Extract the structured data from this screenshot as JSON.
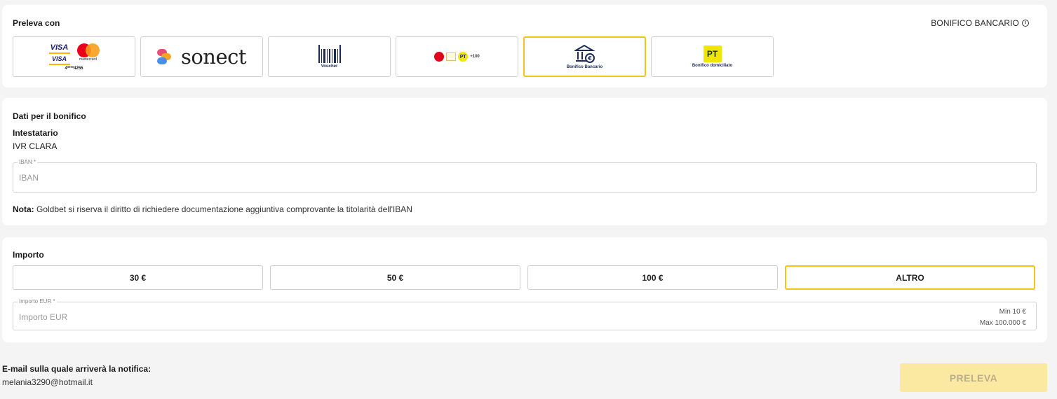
{
  "method_section": {
    "title": "Preleva con",
    "selected_method_label": "BONIFICO BANCARIO",
    "methods": [
      {
        "id": "card",
        "logo_text": "VISA",
        "logo_text_2": "VISA",
        "mc_label": "mastercard",
        "card_number": "4****4255"
      },
      {
        "id": "sonect",
        "logo_text": "sonect"
      },
      {
        "id": "voucher",
        "caption": "Voucher"
      },
      {
        "id": "multi",
        "badge": "PT",
        "extra": "+100"
      },
      {
        "id": "bonifico",
        "caption": "Bonifico Bancario",
        "selected": true
      },
      {
        "id": "domiciliato",
        "badge": "PT",
        "caption": "Bonifico domiciliato"
      }
    ]
  },
  "bonifico_section": {
    "title": "Dati per il bonifico",
    "holder_label": "Intestatario",
    "holder_value": "IVR CLARA",
    "iban_legend": "IBAN *",
    "iban_placeholder": "IBAN",
    "note_prefix": "Nota:",
    "note_text": " Goldbet si riserva il diritto di richiedere documentazione aggiuntiva comprovante la titolarità dell'IBAN"
  },
  "importo_section": {
    "title": "Importo",
    "amounts": [
      "30 €",
      "50 €",
      "100 €",
      "ALTRO"
    ],
    "selected_amount": "ALTRO",
    "amount_legend": "Importo EUR *",
    "amount_placeholder": "Importo EUR",
    "min_text": "Min 10 €",
    "max_text": "Max 100.000 €"
  },
  "footer": {
    "email_label": "E-mail sulla quale arriverà la notifica:",
    "email_value": "melania3290@hotmail.it",
    "submit_label": "PRELEVA"
  },
  "colors": {
    "accent": "#f2c518",
    "button_disabled": "#fbe9a2"
  }
}
